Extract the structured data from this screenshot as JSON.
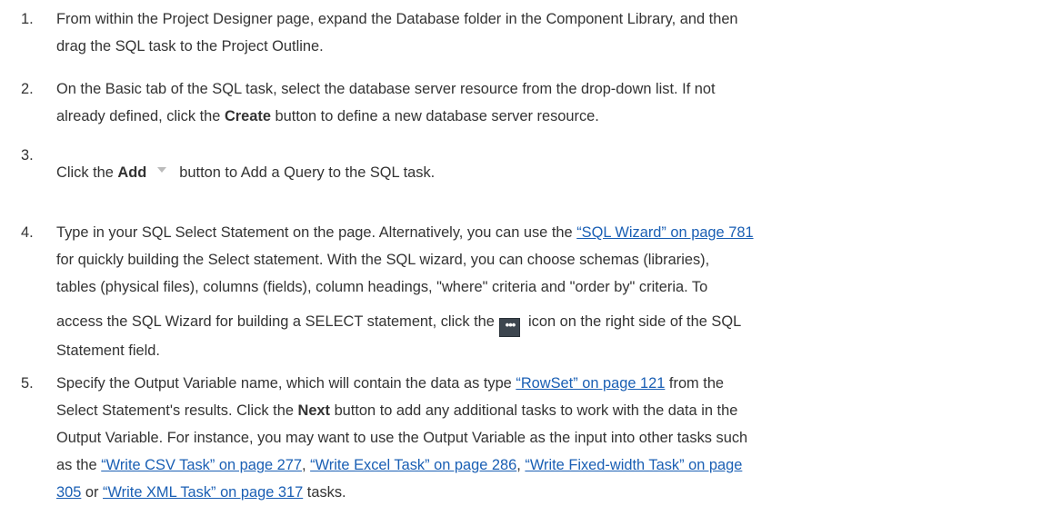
{
  "steps": [
    {
      "number": "1.",
      "lines": [
        "From within the Project Designer page, expand the Database folder in the Component Library, and then",
        "drag the SQL task to the Project Outline."
      ]
    },
    {
      "number": "2.",
      "line1": "On the Basic tab of the SQL task, select the database server resource from the drop-down list. If not",
      "line2_before": "already defined, click the ",
      "line2_bold": "Create",
      "line2_after": " button to define a new database server resource."
    },
    {
      "number": "3.",
      "before": "Click the ",
      "bold": "Add",
      "after": "button to Add a Query to the SQL task."
    },
    {
      "number": "4.",
      "line1_before": "Type in your SQL Select Statement on the page. Alternatively, you can use the ",
      "line1_link": "“SQL Wizard” on page 781",
      "line2": "for quickly building the Select statement.  With the SQL wizard, you can choose schemas (libraries),",
      "line3": "tables (physical files), columns (fields), column headings, \"where\" criteria and \"order by\" criteria. To",
      "line4_before": "access the SQL Wizard for building a SELECT statement, click the ",
      "icon_glyph": "•••",
      "line4_after": " icon on the right side of the SQL",
      "line5": "Statement field."
    },
    {
      "number": "5.",
      "line1_before": "Specify the Output Variable name, which will contain the data as type ",
      "line1_link": "“RowSet” on page 121",
      "line1_after": " from the",
      "line2_before": "Select Statement's results. Click the ",
      "line2_bold": "Next",
      "line2_after": " button to add any additional tasks to work with the data in the",
      "line3": "Output Variable. For instance, you may want to use the Output Variable as the input into other tasks such",
      "line4_before": "as the ",
      "link_csv": "“Write CSV Task” on page 277",
      "sep1": ", ",
      "link_excel": "“Write Excel Task” on page 286",
      "sep2": ", ",
      "link_fixed_a": "“Write Fixed-width Task” on page",
      "link_fixed_b": "305",
      "line5_mid": " or ",
      "link_xml": "“Write XML Task” on page 317",
      "line5_after": " tasks."
    }
  ]
}
